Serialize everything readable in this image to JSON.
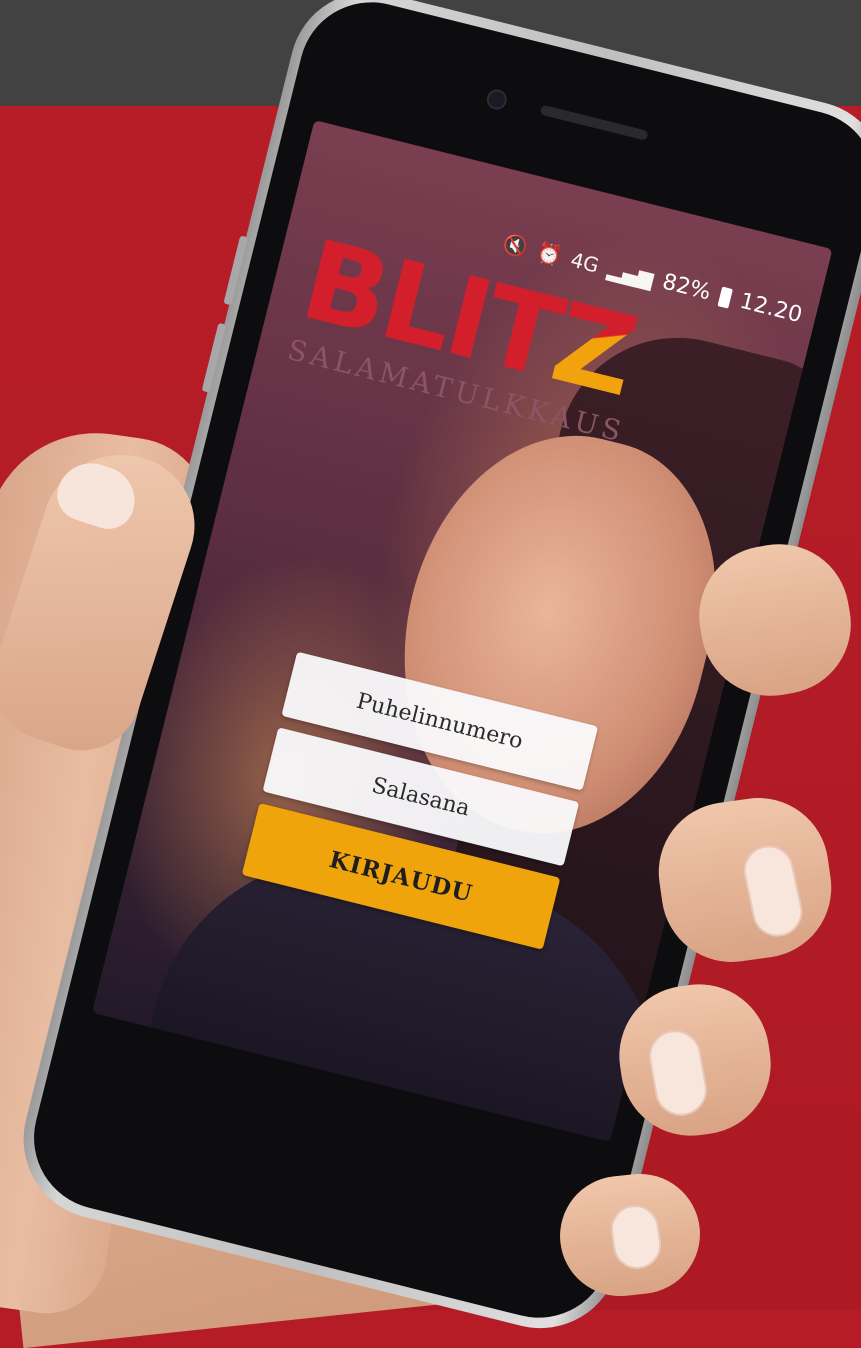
{
  "status_bar": {
    "network": "4G",
    "battery": "82%",
    "time": "12.20"
  },
  "logo": {
    "word_main": "BLIT",
    "word_end": "Z",
    "tagline": "SALAMATULKKAUS"
  },
  "login": {
    "phone_placeholder": "Puhelinnumero",
    "password_placeholder": "Salasana",
    "submit_label": "KIRJAUDU"
  },
  "colors": {
    "brand_red": "#d21f2b",
    "brand_orange": "#f0a40c",
    "background_red": "#b51c26",
    "top_band": "#424242"
  },
  "icons": [
    "mute-icon",
    "alarm-icon",
    "signal-icon",
    "battery-icon"
  ]
}
